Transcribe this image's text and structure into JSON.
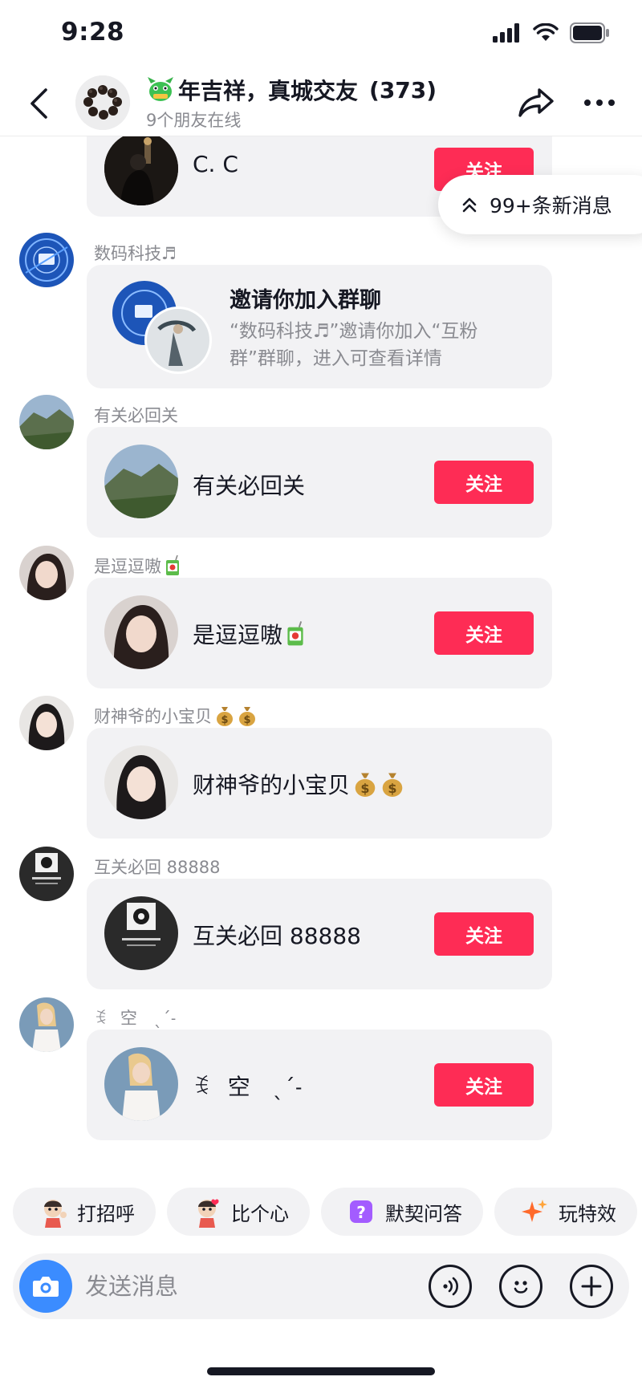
{
  "status_bar": {
    "time": "9:28"
  },
  "header": {
    "group_name": "年吉祥，真城交友",
    "member_count": "(373)",
    "online_text": "9个朋友在线",
    "icons": {
      "back": "back-arrow-icon",
      "share": "share-arrow-icon",
      "more": "more-dots-icon"
    }
  },
  "new_messages": {
    "label": "99+条新消息"
  },
  "messages": [
    {
      "type": "user_card",
      "sender": "",
      "card_name": "C. C",
      "follow_label": "关注"
    },
    {
      "type": "group_invite",
      "sender": "数码科技♬",
      "title": "邀请你加入群聊",
      "description": "“数码科技♬”邀请你加入“互粉群”群聊，进入可查看详情"
    },
    {
      "type": "user_card",
      "sender": "有关必回关",
      "card_name": "有关必回关",
      "follow_label": "关注"
    },
    {
      "type": "user_card",
      "sender": "是逗逗嗷",
      "card_name": "是逗逗嗷",
      "follow_label": "关注"
    },
    {
      "type": "user_card",
      "sender": "财神爷的小宝贝",
      "card_name": "财神爷的小宝贝",
      "follow_label": ""
    },
    {
      "type": "user_card",
      "sender": "互关必回 88888",
      "card_name": "互关必回 88888",
      "follow_label": "关注"
    },
    {
      "type": "user_card",
      "sender": "ꉂ　空　ˎˊ˗",
      "card_name": "ꉂ　空　ˎˊ˗",
      "follow_label": "关注"
    }
  ],
  "quick_actions": [
    {
      "label": "打招呼",
      "icon": "wave-sticker-icon"
    },
    {
      "label": "比个心",
      "icon": "heart-sticker-icon"
    },
    {
      "label": "默契问答",
      "icon": "question-icon"
    },
    {
      "label": "玩特效",
      "icon": "sparkle-icon"
    }
  ],
  "input_bar": {
    "placeholder": "发送消息",
    "icons": [
      "camera-icon",
      "voice-icon",
      "emoji-icon",
      "plus-icon"
    ]
  },
  "colors": {
    "accent": "#fe2c55",
    "camera": "#3b8cff",
    "card_bg": "#f2f2f4",
    "muted_text": "#8a8b91"
  }
}
